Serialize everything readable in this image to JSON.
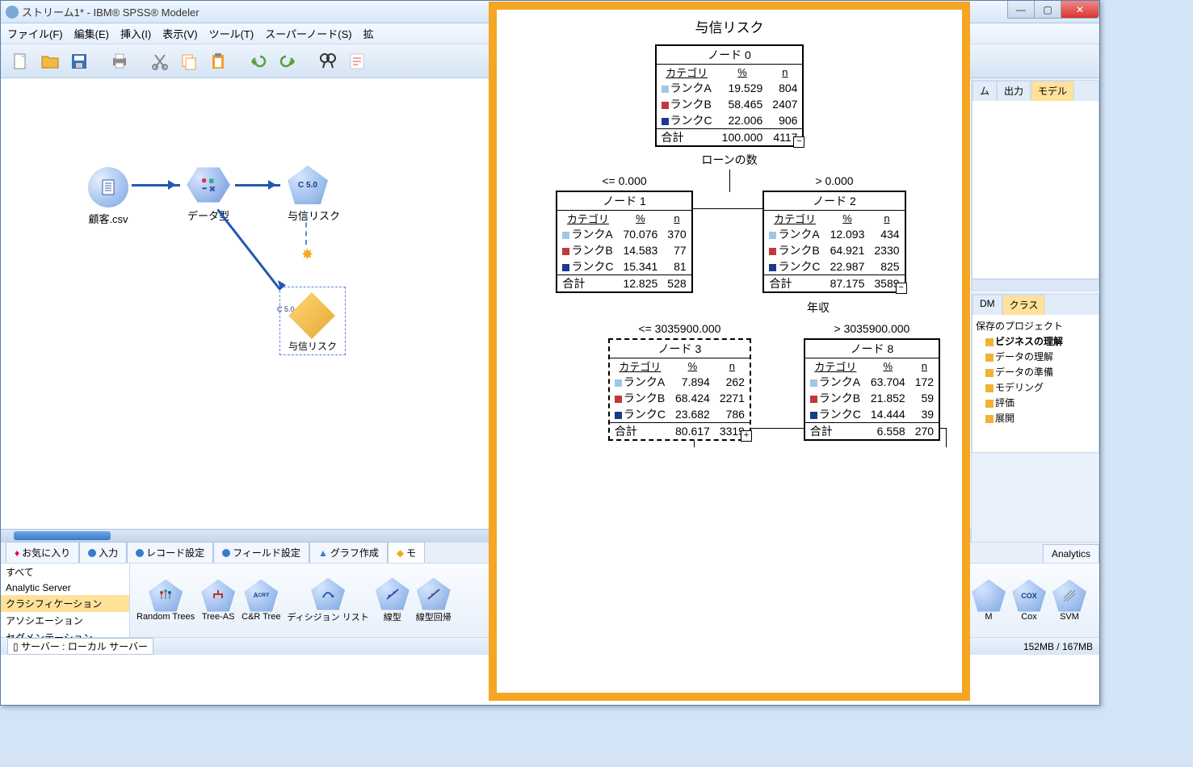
{
  "window": {
    "title": "ストリーム1* - IBM® SPSS® Modeler"
  },
  "winbtns": {
    "min": "—",
    "max": "▢",
    "close": "✕"
  },
  "menu": {
    "file": "ファイル(F)",
    "edit": "編集(E)",
    "insert": "挿入(I)",
    "view": "表示(V)",
    "tools": "ツール(T)",
    "supernode": "スーパーノード(S)",
    "ext": "拡"
  },
  "stream": {
    "n1": "顧客.csv",
    "n2": "データ型",
    "n3": "与信リスク",
    "nugget": "与信リスク",
    "c50": "C 5.0"
  },
  "right_tabs1": {
    "a": "ム",
    "b": "出力",
    "c": "モデル"
  },
  "right_tabs2": {
    "a": "DM",
    "b": "クラス"
  },
  "project": {
    "root": "保存のプロジェクト",
    "i1": "ビジネスの理解",
    "i2": "データの理解",
    "i3": "データの準備",
    "i4": "モデリング",
    "i5": "評価",
    "i6": "展開"
  },
  "palette_tabs": {
    "fav": "お気に入り",
    "input": "入力",
    "record": "レコード設定",
    "field": "フィールド設定",
    "graph": "グラフ作成",
    "model": "モ"
  },
  "palette_tabs2": {
    "analytics": "Analytics"
  },
  "pal_cats": {
    "all": "すべて",
    "as": "Analytic Server",
    "cls": "クラシフィケーション",
    "assoc": "アソシエーション",
    "seg": "セグメンテーション"
  },
  "pal_nodes": {
    "rt": "Random Trees",
    "ta": "Tree-AS",
    "crt": "C&R Tree",
    "dec": "ディシジョン リスト",
    "lin": "線型",
    "linr": "線型回帰",
    "cox": "Cox",
    "svm": "SVM",
    "m": "M"
  },
  "status": {
    "server_label": "サーバー : ローカル サーバー",
    "mem": "152MB / 167MB"
  },
  "tree": {
    "title": "与信リスク",
    "headers": {
      "cat": "カテゴリ",
      "pct": "%",
      "n": "n"
    },
    "labels": {
      "rankA": "ランクA",
      "rankB": "ランクB",
      "rankC": "ランクC",
      "total": "合計"
    },
    "split1": "ローンの数",
    "cond_le0": "<= 0.000",
    "cond_gt0": "> 0.000",
    "split2": "年収",
    "cond_le_inc": "<= 3035900.000",
    "cond_gt_inc": "> 3035900.000",
    "node0": {
      "name": "ノード 0",
      "a_p": "19.529",
      "a_n": "804",
      "b_p": "58.465",
      "b_n": "2407",
      "c_p": "22.006",
      "c_n": "906",
      "t_p": "100.000",
      "t_n": "4117"
    },
    "node1": {
      "name": "ノード 1",
      "a_p": "70.076",
      "a_n": "370",
      "b_p": "14.583",
      "b_n": "77",
      "c_p": "15.341",
      "c_n": "81",
      "t_p": "12.825",
      "t_n": "528"
    },
    "node2": {
      "name": "ノード 2",
      "a_p": "12.093",
      "a_n": "434",
      "b_p": "64.921",
      "b_n": "2330",
      "c_p": "22.987",
      "c_n": "825",
      "t_p": "87.175",
      "t_n": "3589"
    },
    "node3": {
      "name": "ノード 3",
      "a_p": "7.894",
      "a_n": "262",
      "b_p": "68.424",
      "b_n": "2271",
      "c_p": "23.682",
      "c_n": "786",
      "t_p": "80.617",
      "t_n": "3319"
    },
    "node8": {
      "name": "ノード 8",
      "a_p": "63.704",
      "a_n": "172",
      "b_p": "21.852",
      "b_n": "59",
      "c_p": "14.444",
      "c_n": "39",
      "t_p": "6.558",
      "t_n": "270"
    }
  },
  "colors": {
    "rankA": "#9dc8e8",
    "rankB": "#c23838",
    "rankC": "#1a3b8c"
  }
}
